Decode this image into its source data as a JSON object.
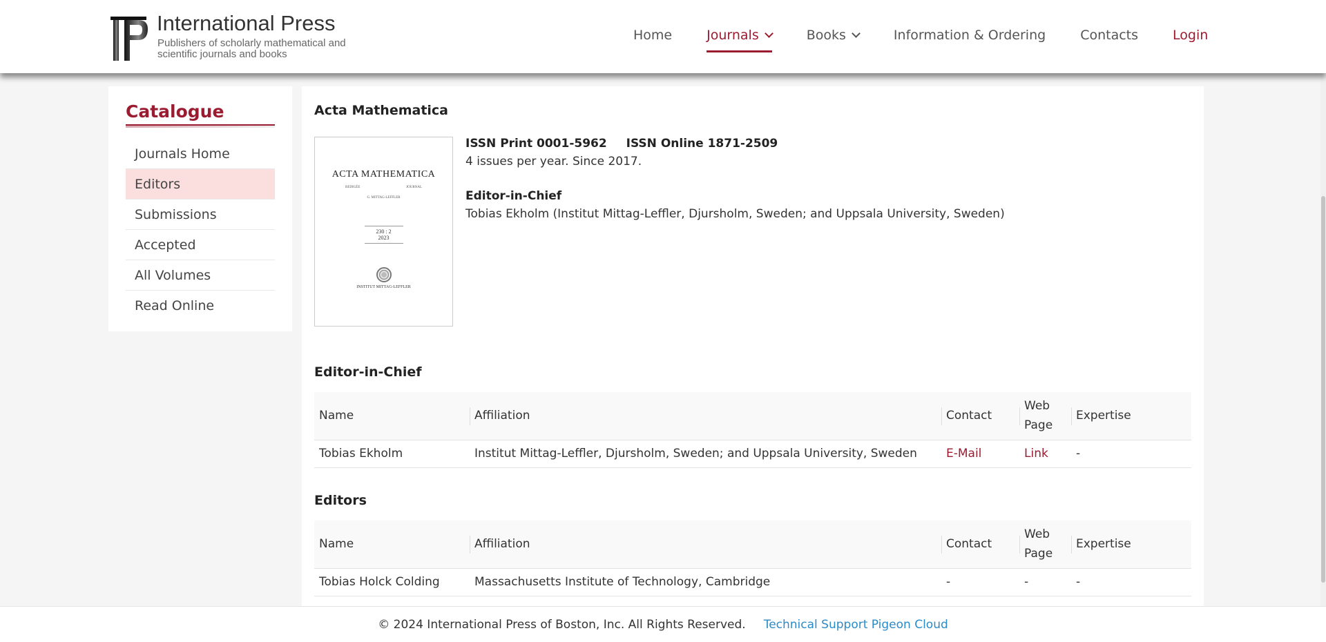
{
  "brand": {
    "name": "International Press",
    "tagline": "Publishers of scholarly mathematical and scientific journals and books"
  },
  "nav": {
    "home": "Home",
    "journals": "Journals",
    "books": "Books",
    "info": "Information & Ordering",
    "contacts": "Contacts",
    "login": "Login"
  },
  "colors": {
    "accent": "#9b1b30",
    "active_bg": "#fbdede",
    "link_blue": "#2a8bc8"
  },
  "sidebar": {
    "title": "Catalogue",
    "items": [
      "Journals Home",
      "Editors",
      "Submissions",
      "Accepted",
      "All Volumes",
      "Read Online"
    ],
    "active_index": 1
  },
  "journal": {
    "title": "Acta Mathematica",
    "cover": {
      "title": "ACTA MATHEMATICA",
      "left_sub": "REDIGÉE",
      "right_sub": "JOURNAL",
      "editor": "G. MITTAG-LEFFLER",
      "volume": "230 : 2",
      "year": "2023",
      "institute": "INSTITUT MITTAG-LEFFLER"
    },
    "issn_print": "ISSN Print 0001-5962",
    "issn_online": "ISSN Online 1871-2509",
    "frequency": "4 issues per year. Since 2017.",
    "eic_label": "Editor-in-Chief",
    "eic_value": "Tobias Ekholm (Institut Mittag-Leffler, Djursholm, Sweden; and Uppsala University, Sweden)"
  },
  "eic_section": {
    "title": "Editor-in-Chief",
    "headers": {
      "name": "Name",
      "affiliation": "Affiliation",
      "contact": "Contact",
      "web": "Web Page",
      "expertise": "Expertise"
    },
    "rows": [
      {
        "name": "Tobias Ekholm",
        "affiliation": "Institut Mittag-Leffler, Djursholm, Sweden; and Uppsala University, Sweden",
        "contact": "E-Mail",
        "web": "Link",
        "expertise": "-"
      }
    ]
  },
  "editors_section": {
    "title": "Editors",
    "headers": {
      "name": "Name",
      "affiliation": "Affiliation",
      "contact": "Contact",
      "web": "Web Page",
      "expertise": "Expertise"
    },
    "rows": [
      {
        "name": "Tobias Holck Colding",
        "affiliation": "Massachusetts Institute of Technology, Cambridge",
        "contact": "-",
        "web": "-",
        "expertise": "-"
      }
    ]
  },
  "footer": {
    "copyright": "© 2024 International Press of Boston, Inc. All Rights Reserved.",
    "support": "Technical Support Pigeon Cloud"
  }
}
